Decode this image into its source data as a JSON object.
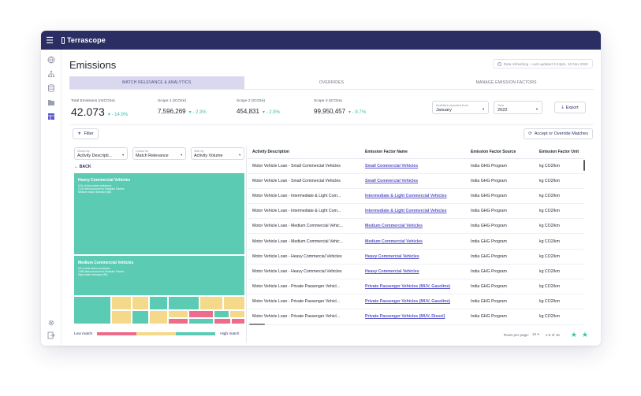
{
  "app": {
    "name": "Terrascope"
  },
  "page": {
    "title": "Emissions",
    "refresh_text": "Data refreshing - Last updated 3:24pm, 10 Nov 2022"
  },
  "tabs": [
    {
      "label": "MATCH RELEVANCE & ANALYTICS",
      "active": true
    },
    {
      "label": "OVERRIDES",
      "active": false
    },
    {
      "label": "MANAGE EMISSION FACTORS",
      "active": false
    }
  ],
  "kpis": [
    {
      "label": "Total Emissions (mtCO2e)",
      "value": "42.073",
      "delta": "- 14.9%"
    },
    {
      "label": "Scope 1 (tCO2e)",
      "value": "7,596,269",
      "delta": "- 2.3%"
    },
    {
      "label": "Scope 2 (tCO2e)",
      "value": "454,831",
      "delta": "- 2.9%"
    },
    {
      "label": "Scope 3 (tCO2e)",
      "value": "99,950,457",
      "delta": "- 9.7%"
    }
  ],
  "filters": {
    "activities_label": "Activities reported from",
    "activities_value": "January",
    "year_label": "Year",
    "year_value": "2022",
    "export_label": "Export"
  },
  "toolbar": {
    "filter_label": "Filter",
    "accept_label": "Accept or Override Matches"
  },
  "left": {
    "group_by": {
      "label": "Group by",
      "value": "Activity Descripti..."
    },
    "colour_by": {
      "label": "Colour by",
      "value": "Match Relevance"
    },
    "size_by": {
      "label": "Size by",
      "value": "Activity Volume"
    },
    "back_label": "BACK",
    "blocks": [
      {
        "title": "Heavy Commercial Vehicles",
        "lines": [
          "11% of total carbon emissions",
          "2,234 items account for Emission Factors",
          "Medium match relevance (86)"
        ]
      },
      {
        "title": "Medium Commercial Vehicles",
        "lines": [
          "9% of total carbon emissions",
          "2,983 items account for Emission Factors",
          "High match relevance (94)"
        ]
      }
    ],
    "legend": {
      "low": "Low match",
      "high": "High match"
    }
  },
  "colors": {
    "accent": "#2b2e63",
    "teal": "#5ccbb4",
    "yellow": "#f4d98a",
    "pink": "#ee6c8a",
    "lavender": "#d9d8ef",
    "link": "#5b57c9"
  },
  "table": {
    "columns": [
      "Activity Description",
      "Emission Factor Name",
      "Emission Factor Source",
      "Emission Factor Unit"
    ],
    "rows": [
      [
        "Motor Vehicle Loan - Small Commercial Vehicles",
        "Small Commercial Vehicles",
        "India GHG Program",
        "kg CO2/km"
      ],
      [
        "Motor Vehicle Loan - Small Commercial Vehicles",
        "Small Commercial Vehicles",
        "India GHG Program",
        "kg CO2/km"
      ],
      [
        "Motor Vehicle Loan - Intermediate & Light Com...",
        "Intermediate & Light Commercial Vehicles",
        "India GHG Program",
        "kg CO2/km"
      ],
      [
        "Motor Vehicle Loan - Intermediate & Light Com...",
        "Intermediate & Light Commercial Vehicles",
        "India GHG Program",
        "kg CO2/km"
      ],
      [
        "Motor Vehicle Loan - Medium Commercial Vehic...",
        "Medium Commercial Vehicles",
        "India GHG Program",
        "kg CO2/km"
      ],
      [
        "Motor Vehicle Loan - Medium Commercial Vehic...",
        "Medium Commercial Vehicles",
        "India GHG Program",
        "kg CO2/km"
      ],
      [
        "Motor Vehicle Loan - Heavy Commercial Vehicles",
        "Heavy Commercial Vehicles",
        "India GHG Program",
        "kg CO2/km"
      ],
      [
        "Motor Vehicle Loan - Heavy Commercial Vehicles",
        "Heavy Commercial Vehicles",
        "India GHG Program",
        "kg CO2/km"
      ],
      [
        "Motor Vehicle Loan - Private Passenger Vehicl...",
        "Private Passenger Vehicles (MUV, Gasoline)",
        "India GHG Program",
        "kg CO2/km"
      ],
      [
        "Motor Vehicle Loan - Private Passenger Vehicl...",
        "Private Passenger Vehicles (MUV, Gasoline)",
        "India GHG Program",
        "kg CO2/km"
      ],
      [
        "Motor Vehicle Loan - Private Passenger Vehicl...",
        "Private Passenger Vehicles (MUV, Diesel)",
        "India GHG Program",
        "kg CO2/km"
      ]
    ]
  },
  "pagination": {
    "rows_label": "Rows per page:",
    "rows_value": "15",
    "range": "1-5 of 15"
  }
}
